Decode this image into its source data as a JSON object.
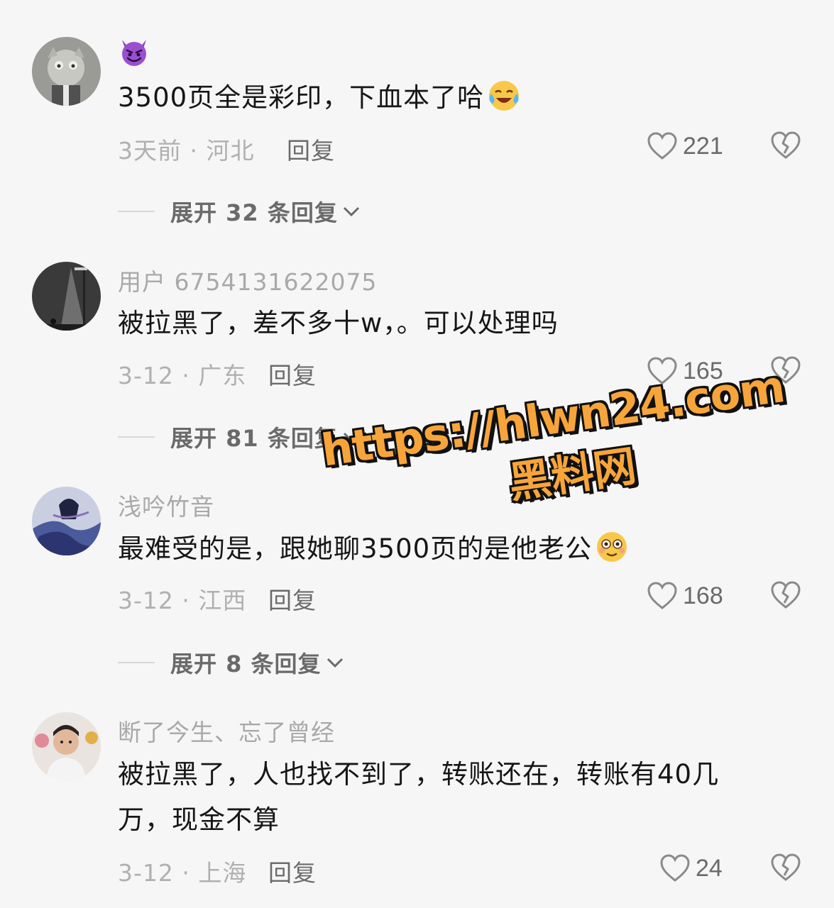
{
  "comments": [
    {
      "username": "",
      "username_icon": "smiling-devil-emoji-icon",
      "text": "3500页全是彩印，下血本了哈",
      "text_emoji": "crying-laughing-emoji-icon",
      "meta": "3天前 · 河北",
      "reply_label": "回复",
      "likes": "221",
      "expand_label": "展开 32 条回复"
    },
    {
      "username": "用户 6754131622075",
      "text": "被拉黑了，差不多十w，。可以处理吗",
      "meta": "3-12 · 广东",
      "reply_label": "回复",
      "likes": "165",
      "expand_label": "展开 81 条回复"
    },
    {
      "username": "浅吟竹音",
      "text": "最难受的是，跟她聊3500页的是他老公",
      "text_emoji": "flushed-emoji-icon",
      "meta": "3-12 · 江西",
      "reply_label": "回复",
      "likes": "168",
      "expand_label": "展开 8 条回复"
    },
    {
      "username": "断了今生、忘了曾经",
      "text": "被拉黑了，人也找不到了，转账还在，转账有40几万，现金不算",
      "meta": "3-12 · 上海",
      "reply_label": "回复",
      "likes": "24"
    }
  ],
  "watermark": {
    "url": "https://hlwn24.com",
    "name": "黑料网"
  },
  "colors": {
    "background": "#f6f6f6",
    "text_primary": "#161616",
    "text_secondary": "#a9a9a9",
    "watermark_fill": "#f7a53a"
  }
}
